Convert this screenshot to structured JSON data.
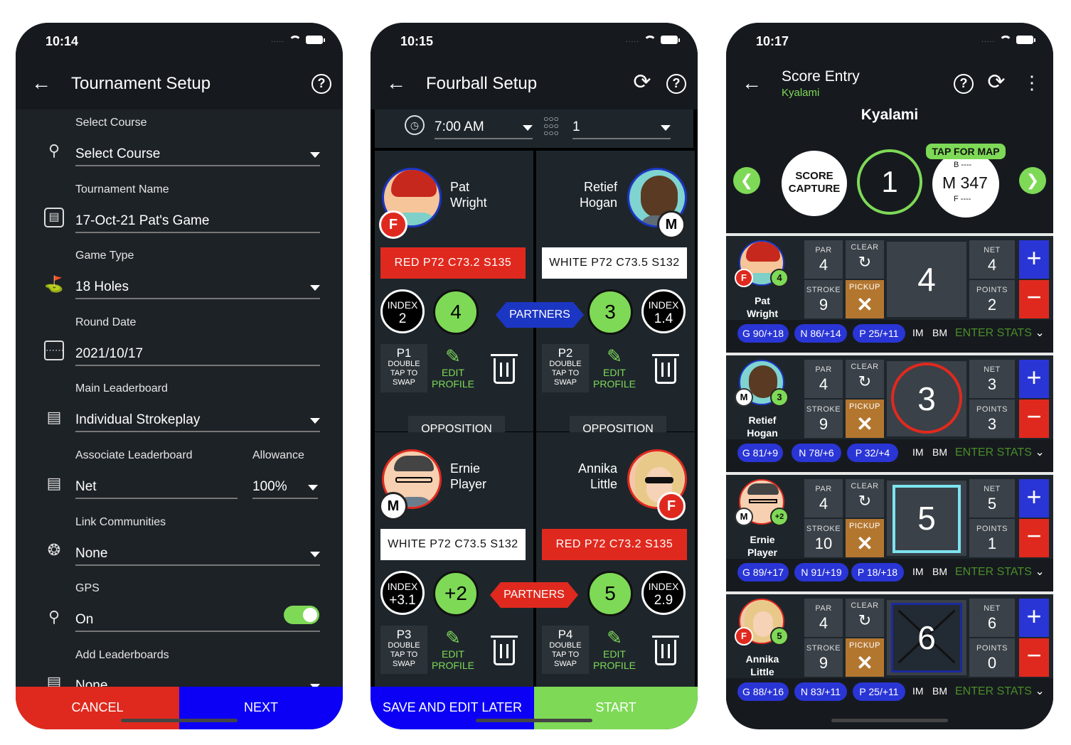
{
  "status_bar": {
    "p1_time": "10:14",
    "p2_time": "10:15",
    "p3_time": "10:17",
    "signal": "....."
  },
  "setup": {
    "title": "Tournament Setup",
    "help_icon": "?",
    "fields": [
      {
        "label": "Select Course",
        "value": "Select Course"
      },
      {
        "label": "Tournament Name",
        "value": "17-Oct-21 Pat's Game"
      },
      {
        "label": "Game Type",
        "value": "18 Holes"
      },
      {
        "label": "Round Date",
        "value": "2021/10/17"
      },
      {
        "label": "Main Leaderboard",
        "value": "Individual Strokeplay"
      },
      {
        "label": "Associate Leaderboard",
        "value": "Net"
      },
      {
        "label": "Link Communities",
        "value": "None"
      },
      {
        "label": "GPS",
        "value": "On"
      },
      {
        "label": "Add Leaderboards",
        "value": "None"
      }
    ],
    "allowance_label": "Allowance",
    "allowance_value": "100%",
    "gps_enabled": true,
    "cancel": "CANCEL",
    "next": "NEXT"
  },
  "fourball": {
    "title": "Fourball Setup",
    "tee_time": "7:00 AM",
    "start_hole": "1",
    "partners": "PARTNERS",
    "opposition": "OPPOSITION",
    "index_label": "INDEX",
    "edit_label_1": "EDIT",
    "edit_label_2": "PROFILE",
    "swap_1": "DOUBLE",
    "swap_2": "TAP TO",
    "swap_3": "SWAP",
    "players": [
      {
        "slot": "P1",
        "first": "Pat",
        "last": "Wright",
        "gender": "F",
        "tee": "RED   P72   C73.2   S135",
        "index": "2",
        "score": "4"
      },
      {
        "slot": "P2",
        "first": "Retief",
        "last": "Hogan",
        "gender": "M",
        "tee": "WHITE  P72  C73.5  S132",
        "index": "1.4",
        "score": "3"
      },
      {
        "slot": "P3",
        "first": "Ernie",
        "last": "Player",
        "gender": "M",
        "tee": "WHITE  P72  C73.5  S132",
        "index": "+3.1",
        "score": "+2"
      },
      {
        "slot": "P4",
        "first": "Annika",
        "last": "Little",
        "gender": "F",
        "tee": "RED   P72   C73.2   S135",
        "index": "2.9",
        "score": "5"
      }
    ],
    "save": "SAVE AND EDIT LATER",
    "start": "START"
  },
  "score": {
    "title": "Score Entry",
    "subtitle": "Kyalami",
    "course": "Kyalami",
    "hole": "1",
    "logo_1": "SCORE",
    "logo_2": "CAPTURE",
    "map_tag": "TAP FOR MAP",
    "map_b": "B ----",
    "map_m": "M 347",
    "map_f": "F ----",
    "par_label": "PAR",
    "clear_label": "CLEAR",
    "stroke_label": "STROKE",
    "pickup_label": "PICKUP",
    "net_label": "NET",
    "points_label": "POINTS",
    "im": "IM",
    "bm": "BM",
    "enter_stats": "ENTER STATS",
    "rows": [
      {
        "first": "Pat",
        "last": "Wright",
        "gender": "F",
        "shots": "4",
        "par": "4",
        "stroke": "9",
        "score": "4",
        "net": "4",
        "points": "2",
        "g": "G 90/+18",
        "n": "N 86/+14",
        "p": "P 25/+11"
      },
      {
        "first": "Retief",
        "last": "Hogan",
        "gender": "M",
        "shots": "3",
        "par": "4",
        "stroke": "9",
        "score": "3",
        "net": "3",
        "points": "3",
        "g": "G 81/+9",
        "n": "N 78/+6",
        "p": "P 32/+4"
      },
      {
        "first": "Ernie",
        "last": "Player",
        "gender": "M",
        "shots": "+2",
        "par": "4",
        "stroke": "10",
        "score": "5",
        "net": "5",
        "points": "1",
        "g": "G 89/+17",
        "n": "N 91/+19",
        "p": "P 18/+18"
      },
      {
        "first": "Annika",
        "last": "Little",
        "gender": "F",
        "shots": "5",
        "par": "4",
        "stroke": "9",
        "score": "6",
        "net": "6",
        "points": "0",
        "g": "G 88/+16",
        "n": "N 83/+11",
        "p": "P 25/+11"
      }
    ]
  },
  "colors": {
    "green": "#7ed957",
    "red": "#e0291e",
    "blue": "#2a35d6",
    "cyan": "#7de3f0"
  }
}
